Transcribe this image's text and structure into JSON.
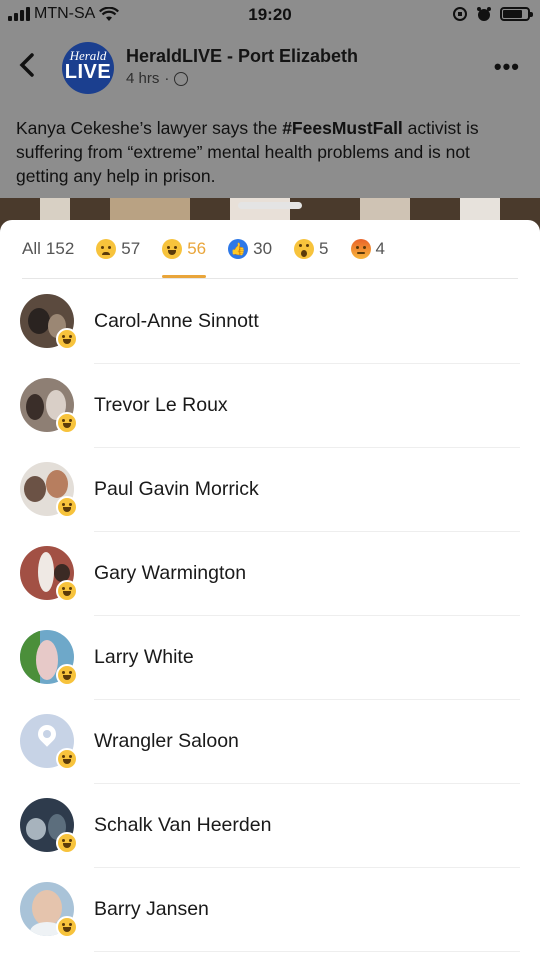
{
  "status_bar": {
    "carrier": "MTN-SA",
    "time": "19:20"
  },
  "post": {
    "page_name": "HeraldLIVE - Port Elizabeth",
    "logo_line1": "Herald",
    "logo_line2": "LIVE",
    "time_ago": "4 hrs",
    "meta_separator": "·",
    "text_before": "Kanya Cekeshe’s lawyer says the ",
    "hashtag": "#FeesMustFall",
    "text_after": " activist is suffering from “extreme” mental health problems and is not getting any help in prison."
  },
  "reactions": {
    "tabs": [
      {
        "label": "All",
        "count": "152",
        "icon": "none"
      },
      {
        "label": "",
        "count": "57",
        "icon": "sad-icon"
      },
      {
        "label": "",
        "count": "56",
        "icon": "haha-icon",
        "active": true
      },
      {
        "label": "",
        "count": "30",
        "icon": "like-icon"
      },
      {
        "label": "",
        "count": "5",
        "icon": "wow-icon"
      },
      {
        "label": "",
        "count": "4",
        "icon": "angry-icon"
      }
    ],
    "accent_color": "#e9a53a",
    "people": [
      {
        "name": "Carol-Anne Sinnott",
        "reaction": "haha-icon"
      },
      {
        "name": "Trevor Le Roux",
        "reaction": "haha-icon"
      },
      {
        "name": "Paul Gavin Morrick",
        "reaction": "haha-icon"
      },
      {
        "name": "Gary Warmington",
        "reaction": "haha-icon"
      },
      {
        "name": "Larry White",
        "reaction": "haha-icon"
      },
      {
        "name": "Wrangler Saloon",
        "reaction": "haha-icon"
      },
      {
        "name": "Schalk Van Heerden",
        "reaction": "haha-icon"
      },
      {
        "name": "Barry Jansen",
        "reaction": "haha-icon"
      }
    ]
  }
}
